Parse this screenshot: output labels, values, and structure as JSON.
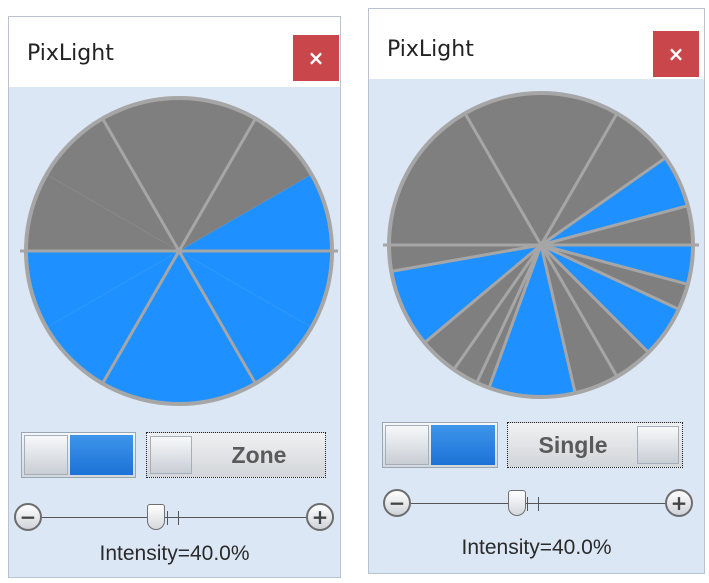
{
  "colors": {
    "on": "#1e90ff",
    "off": "#7f7f7f",
    "divider": "#a6a6a6"
  },
  "windows": [
    {
      "title": "PixLight",
      "close_icon": "×",
      "mode_label": "Zone",
      "intensity_text": "Intensity=40.0%",
      "intensity_value": 40.0,
      "minus_icon": "−",
      "plus_icon": "+",
      "segments": [
        {
          "from": 0,
          "to": 30,
          "lit": true
        },
        {
          "from": 30,
          "to": 60,
          "lit": false
        },
        {
          "from": 60,
          "to": 90,
          "lit": false
        },
        {
          "from": 90,
          "to": 120,
          "lit": false
        },
        {
          "from": 120,
          "to": 150,
          "lit": false
        },
        {
          "from": 150,
          "to": 180,
          "lit": false
        },
        {
          "from": 180,
          "to": 210,
          "lit": true
        },
        {
          "from": 210,
          "to": 240,
          "lit": true
        },
        {
          "from": 240,
          "to": 270,
          "lit": true
        },
        {
          "from": 270,
          "to": 300,
          "lit": true
        },
        {
          "from": 300,
          "to": 330,
          "lit": true
        },
        {
          "from": 330,
          "to": 360,
          "lit": true
        }
      ],
      "dividers": [
        0,
        60,
        120,
        180,
        240,
        300
      ]
    },
    {
      "title": "PixLight",
      "close_icon": "×",
      "mode_label": "Single",
      "intensity_text": "Intensity=40.0%",
      "intensity_value": 40.0,
      "minus_icon": "−",
      "plus_icon": "+",
      "segments": [
        {
          "from": 0,
          "to": 15,
          "lit": false
        },
        {
          "from": 15,
          "to": 35,
          "lit": true
        },
        {
          "from": 35,
          "to": 60,
          "lit": false
        },
        {
          "from": 60,
          "to": 120,
          "lit": false
        },
        {
          "from": 120,
          "to": 180,
          "lit": false
        },
        {
          "from": 180,
          "to": 190,
          "lit": false
        },
        {
          "from": 190,
          "to": 220,
          "lit": true
        },
        {
          "from": 220,
          "to": 235,
          "lit": false
        },
        {
          "from": 235,
          "to": 245,
          "lit": false
        },
        {
          "from": 245,
          "to": 250,
          "lit": false
        },
        {
          "from": 250,
          "to": 283,
          "lit": true
        },
        {
          "from": 283,
          "to": 300,
          "lit": false
        },
        {
          "from": 300,
          "to": 315,
          "lit": false
        },
        {
          "from": 315,
          "to": 335,
          "lit": true
        },
        {
          "from": 335,
          "to": 345,
          "lit": false
        },
        {
          "from": 345,
          "to": 360,
          "lit": true
        }
      ],
      "dividers": [
        0,
        15,
        35,
        60,
        120,
        180,
        190,
        220,
        235,
        245,
        250,
        283,
        300,
        315,
        335,
        345
      ]
    }
  ]
}
